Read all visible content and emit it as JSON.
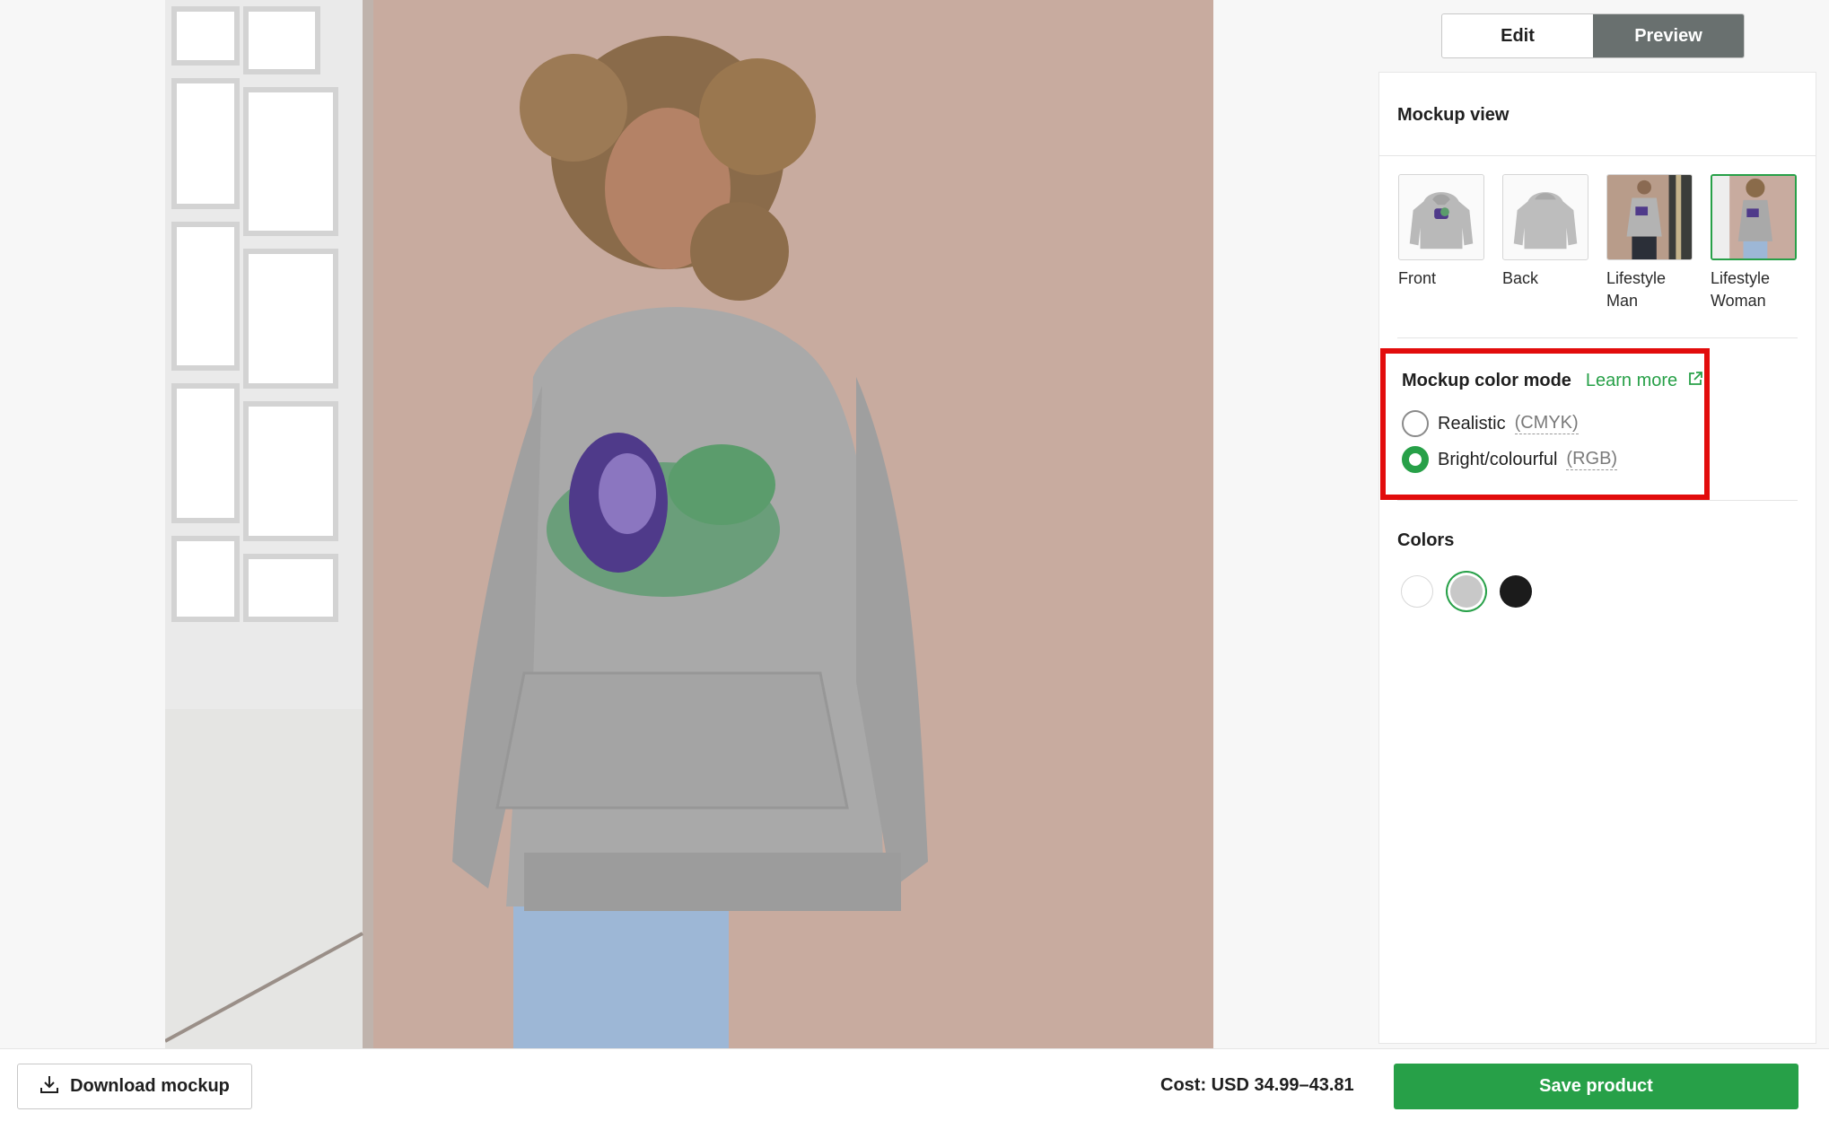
{
  "mode_toggle": {
    "edit_label": "Edit",
    "preview_label": "Preview",
    "active": "Preview"
  },
  "mockup_view": {
    "title": "Mockup view",
    "thumbnails": [
      {
        "label": "Front",
        "selected": false
      },
      {
        "label": "Back",
        "selected": false
      },
      {
        "label": "Lifestyle Man",
        "selected": false
      },
      {
        "label": "Lifestyle Woman",
        "selected": true
      }
    ]
  },
  "color_mode": {
    "title": "Mockup color mode",
    "learn_more": "Learn more",
    "options": [
      {
        "label": "Realistic",
        "paren": "(CMYK)",
        "checked": false
      },
      {
        "label": "Bright/colourful",
        "paren": "(RGB)",
        "checked": true
      }
    ]
  },
  "colors": {
    "title": "Colors",
    "swatches": [
      {
        "name": "white",
        "hex": "#ffffff",
        "selected": false
      },
      {
        "name": "grey",
        "hex": "#c8c8c8",
        "selected": true
      },
      {
        "name": "black",
        "hex": "#1b1b1b",
        "selected": false
      }
    ]
  },
  "footer": {
    "download_label": "Download mockup",
    "cost": "Cost: USD 34.99–43.81",
    "save_label": "Save product"
  },
  "theme": {
    "accent": "#27a048",
    "highlight": "#e20c0c",
    "active_tab": "#69706f"
  }
}
